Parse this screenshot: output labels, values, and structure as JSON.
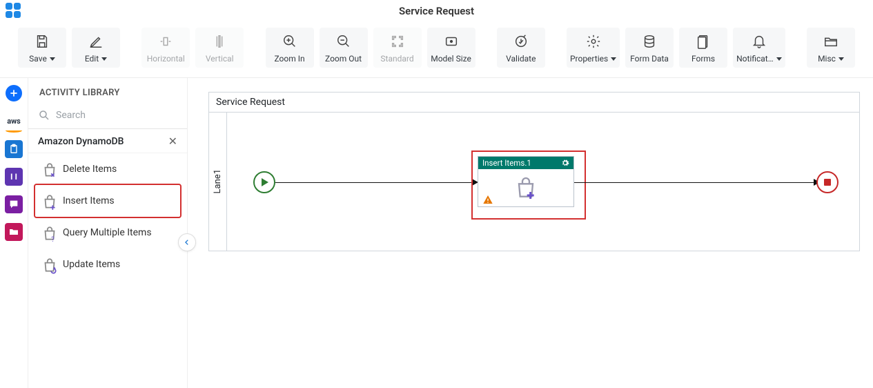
{
  "header": {
    "title": "Service Request"
  },
  "toolbar": {
    "save": "Save",
    "edit": "Edit",
    "horizontal": "Horizontal",
    "vertical": "Vertical",
    "zoom_in": "Zoom In",
    "zoom_out": "Zoom Out",
    "standard": "Standard",
    "model_size": "Model Size",
    "validate": "Validate",
    "properties": "Properties",
    "form_data": "Form Data",
    "forms": "Forms",
    "notification": "Notificat…",
    "misc": "Misc"
  },
  "leftrail": {
    "aws_label": "aws"
  },
  "library": {
    "title": "ACTIVITY LIBRARY",
    "search_placeholder": "Search",
    "category": "Amazon DynamoDB",
    "items": [
      {
        "label": "Delete Items",
        "icon": "bag-x"
      },
      {
        "label": "Insert Items",
        "icon": "bag-plus",
        "highlight": true
      },
      {
        "label": "Query Multiple Items",
        "icon": "bag-q"
      },
      {
        "label": "Update Items",
        "icon": "bag-c"
      }
    ]
  },
  "canvas": {
    "title": "Service Request",
    "lane_label": "Lane1",
    "activity": {
      "title": "Insert Items.1"
    }
  }
}
